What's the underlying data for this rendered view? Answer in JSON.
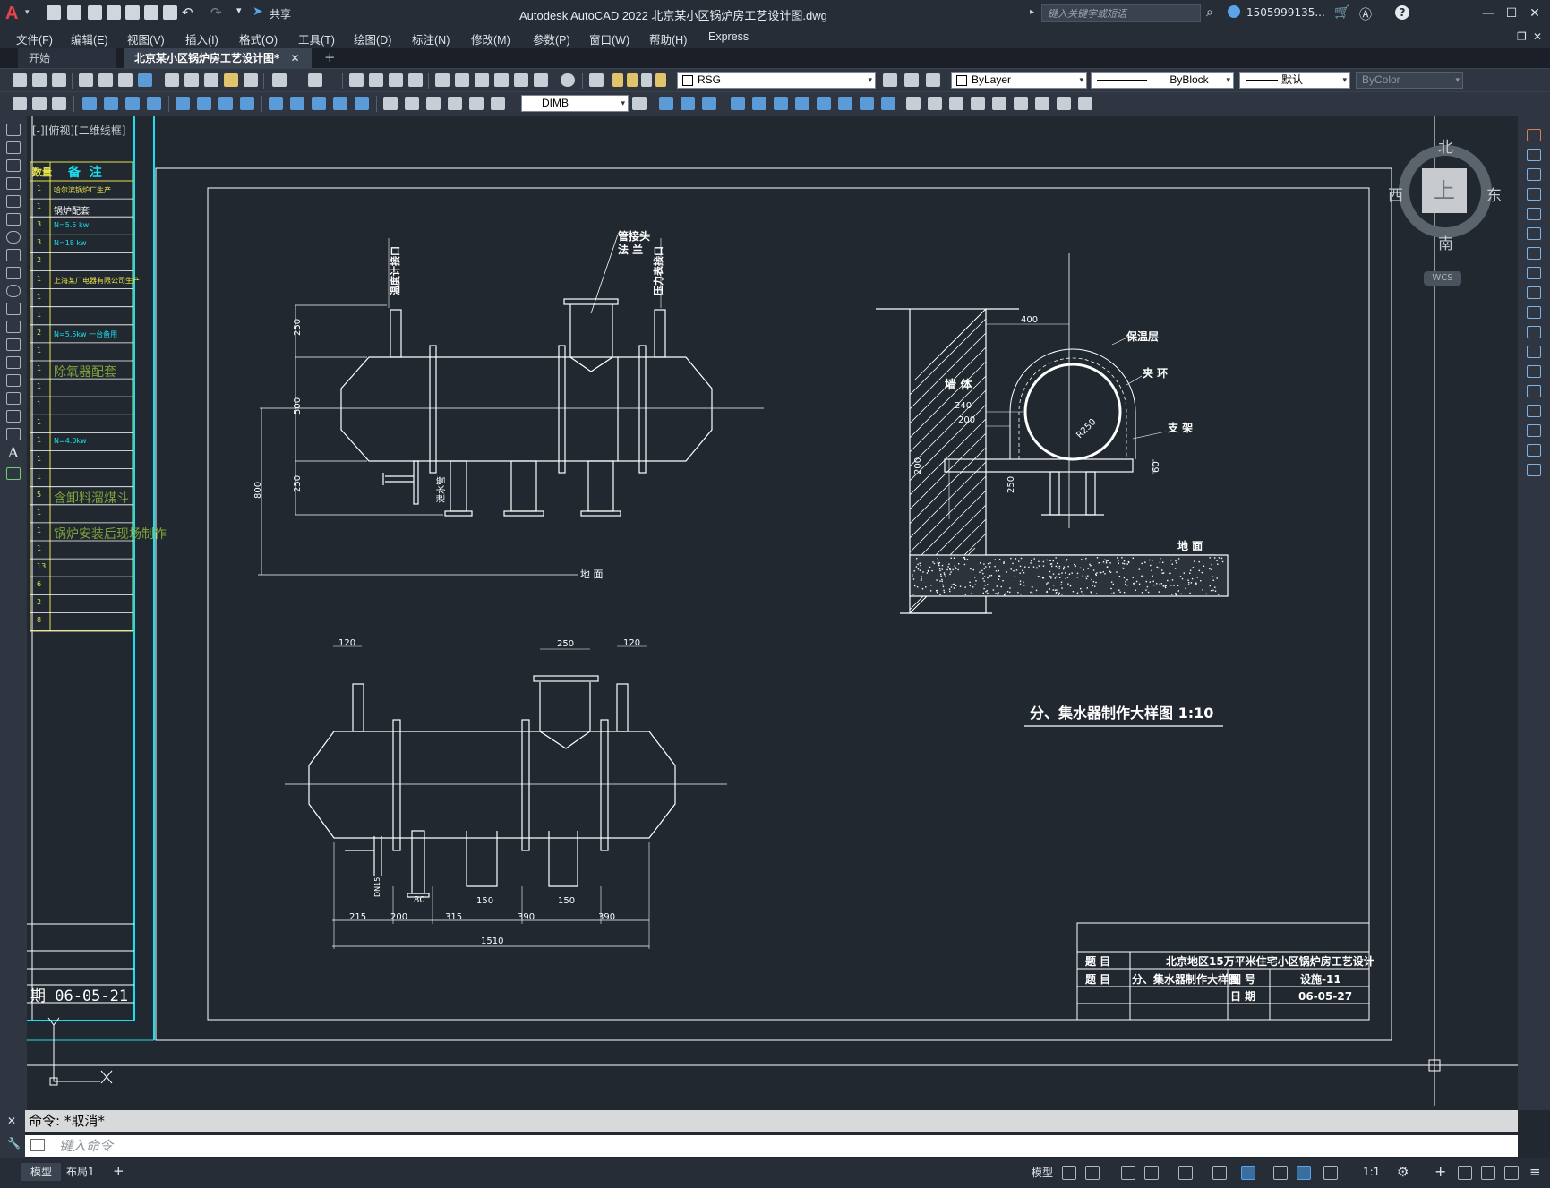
{
  "app": {
    "title": "Autodesk AutoCAD 2022    北京某小区锅炉房工艺设计图.dwg",
    "share_label": "共享",
    "search_placeholder": "键入关键字或短语",
    "user": "1505999135...",
    "accent": "#e8424a"
  },
  "menu": [
    "文件(F)",
    "编辑(E)",
    "视图(V)",
    "插入(I)",
    "格式(O)",
    "工具(T)",
    "绘图(D)",
    "标注(N)",
    "修改(M)",
    "参数(P)",
    "窗口(W)",
    "帮助(H)",
    "Express"
  ],
  "tabs": {
    "start": "开始",
    "drawing": "北京某小区锅炉房工艺设计图*"
  },
  "toolbar": {
    "layer": "RSG",
    "color": "ByLayer",
    "linetype": "ByBlock",
    "lineweight": "默认",
    "plotstyle": "ByColor",
    "dimstyle": "DIMB"
  },
  "viewport_label": "[-][俯视][二维线框]",
  "viewcube": {
    "north": "北",
    "south": "南",
    "east": "东",
    "west": "西",
    "top": "上",
    "wcs": "WCS"
  },
  "table": {
    "header_qty": "数量",
    "header_note": "备  注",
    "rows": [
      {
        "qty": "1",
        "note": "哈尔滨锅炉厂生产"
      },
      {
        "qty": "1",
        "note": "锅炉配套"
      },
      {
        "qty": "3",
        "note": "N=5.5 kw"
      },
      {
        "qty": "3",
        "note": "N=18 kw"
      },
      {
        "qty": "2",
        "note": ""
      },
      {
        "qty": "1",
        "note": "上海某厂电器有限公司生产"
      },
      {
        "qty": "1",
        "note": ""
      },
      {
        "qty": "1",
        "note": ""
      },
      {
        "qty": "2",
        "note": "N=5.5kw  一台备用"
      },
      {
        "qty": "1",
        "note": ""
      },
      {
        "qty": "1",
        "note": "除氧器配套"
      },
      {
        "qty": "1",
        "note": ""
      },
      {
        "qty": "1",
        "note": ""
      },
      {
        "qty": "1",
        "note": ""
      },
      {
        "qty": "1",
        "note": "N=4.0kw"
      },
      {
        "qty": "1",
        "note": ""
      },
      {
        "qty": "1",
        "note": ""
      },
      {
        "qty": "5",
        "note": "含卸料溜煤斗"
      },
      {
        "qty": "1",
        "note": ""
      },
      {
        "qty": "1",
        "note": "锅炉安装后现场制作"
      },
      {
        "qty": "1",
        "note": ""
      },
      {
        "qty": "13",
        "note": ""
      },
      {
        "qty": "6",
        "note": ""
      },
      {
        "qty": "2",
        "note": ""
      },
      {
        "qty": "8",
        "note": ""
      }
    ],
    "date": "期 06-05-21"
  },
  "drawing": {
    "labels": {
      "thermo_port": "温度计接口",
      "pipe_joint": "管接头",
      "flange": "法  兰",
      "pressure_port": "压力表接口",
      "drain": "泄水管",
      "ground": "地  面",
      "ground2": "地  面",
      "insulation": "保温层",
      "clamp": "夹  环",
      "support": "支  架",
      "wall": "墙  体",
      "radius": "R250"
    },
    "dims_side": [
      "250",
      "500",
      "250",
      "800"
    ],
    "dims_section": [
      "400",
      "240",
      "200",
      "200",
      "250",
      "60"
    ],
    "dims_top": [
      "120",
      "250",
      "120"
    ],
    "dims_bottom": [
      "215",
      "200",
      "80",
      "315",
      "150",
      "390",
      "150",
      "390",
      "1510"
    ],
    "drain_small": "DN15",
    "caption": "分、集水器制作大样图  1:10"
  },
  "titleblock": {
    "label_project": "题    目",
    "project": "北京地区15万平米住宅小区锅炉房工艺设计",
    "label_title": "题    目",
    "title": "分、集水器制作大样图",
    "label_no": "图    号",
    "no": "设施-11",
    "label_date": "日    期",
    "date": "06-05-27"
  },
  "command": {
    "history": "命令: *取消*",
    "placeholder": "键入命令"
  },
  "status": {
    "model": "模型",
    "layout": "布局1",
    "scale": "1:1"
  }
}
